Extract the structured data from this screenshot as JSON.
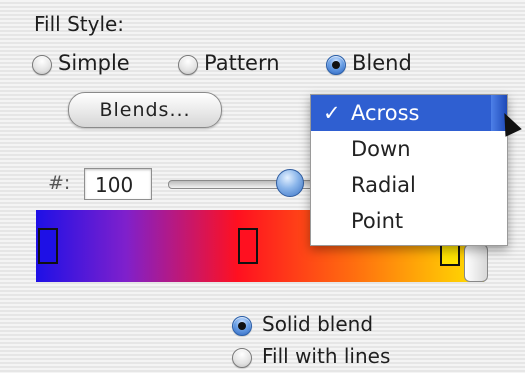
{
  "section_title": "Fill Style:",
  "fill_style_options": [
    {
      "label": "Simple",
      "selected": false
    },
    {
      "label": "Pattern",
      "selected": false
    },
    {
      "label": "Blend",
      "selected": true
    }
  ],
  "blends_button_label": "Blends...",
  "steps": {
    "label": "#:",
    "value": "100",
    "slider_fraction": 0.73
  },
  "blend_direction_menu": {
    "items": [
      {
        "label": "Across",
        "checked": true,
        "check_glyph": "✓"
      },
      {
        "label": "Down",
        "checked": false,
        "check_glyph": ""
      },
      {
        "label": "Radial",
        "checked": false,
        "check_glyph": ""
      },
      {
        "label": "Point",
        "checked": false,
        "check_glyph": ""
      }
    ]
  },
  "gradient": {
    "colors": [
      "#1e10e6",
      "#7f20cc",
      "#ff1020",
      "#ff6a10",
      "#ffe200"
    ],
    "stops": [
      {
        "name": "blue",
        "color": "#1e10e6"
      },
      {
        "name": "red",
        "color": "#ff1020"
      },
      {
        "name": "yellow",
        "color": "#ffe200"
      }
    ]
  },
  "render_options": [
    {
      "label": "Solid blend",
      "selected": true
    },
    {
      "label": "Fill with lines",
      "selected": false
    }
  ],
  "accent_color": "#2f5fd1"
}
